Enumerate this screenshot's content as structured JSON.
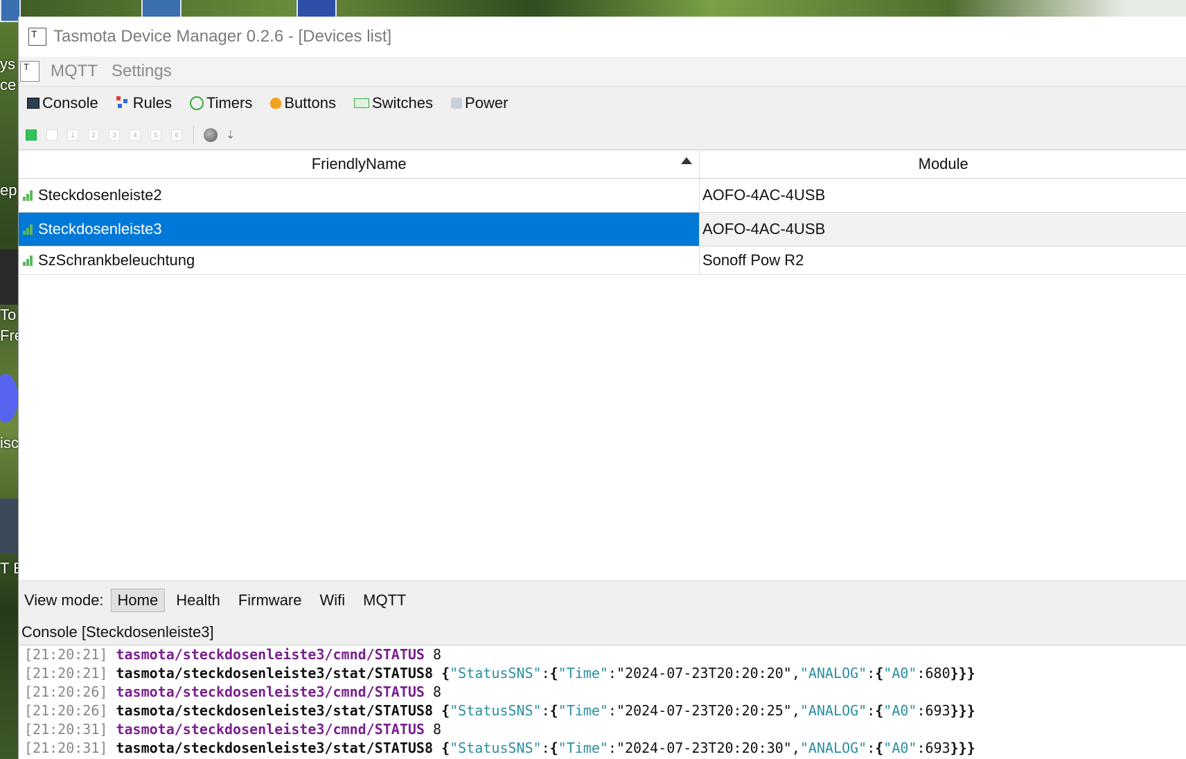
{
  "window": {
    "app_icon_letter": "T",
    "title": "Tasmota Device Manager 0.2.6 - [Devices list]"
  },
  "desktop": {
    "fragments": [
      "ys",
      "ce",
      "ep",
      "To",
      "Fre",
      "iscr",
      "T E"
    ]
  },
  "menubar": {
    "icon_letter": "T",
    "items": [
      "MQTT",
      "Settings"
    ]
  },
  "toolbar": {
    "buttons": [
      {
        "label": "Console",
        "icon": "console-icon"
      },
      {
        "label": "Rules",
        "icon": "rules-icon"
      },
      {
        "label": "Timers",
        "icon": "timers-icon"
      },
      {
        "label": "Buttons",
        "icon": "buttons-icon"
      },
      {
        "label": "Switches",
        "icon": "switches-icon"
      },
      {
        "label": "Power",
        "icon": "power-icon"
      }
    ]
  },
  "ledbar": {
    "leds": [
      "",
      "",
      "1",
      "2",
      "3",
      "4",
      "5",
      "6"
    ]
  },
  "table": {
    "columns": [
      "FriendlyName",
      "Module"
    ],
    "rows": [
      {
        "name": "Steckdosenleiste2",
        "module": "AOFO-4AC-4USB",
        "selected": false
      },
      {
        "name": "Steckdosenleiste3",
        "module": "AOFO-4AC-4USB",
        "selected": true
      },
      {
        "name": "SzSchrankbeleuchtung",
        "module": "Sonoff Pow R2",
        "selected": false
      }
    ]
  },
  "viewmode": {
    "label": "View mode:",
    "tabs": [
      "Home",
      "Health",
      "Firmware",
      "Wifi",
      "MQTT"
    ],
    "active": "Home"
  },
  "console": {
    "title": "Console [Steckdosenleiste3]",
    "lines": [
      {
        "ts": "[21:20:21]",
        "topic": "tasmota/steckdosenleiste3/cmnd/STATUS",
        "kind": "cmnd",
        "payload": "8"
      },
      {
        "ts": "[21:20:21]",
        "topic": "tasmota/steckdosenleiste3/stat/STATUS8",
        "kind": "stat",
        "time": "2024-07-23T20:20:20",
        "a0": "680"
      },
      {
        "ts": "[21:20:26]",
        "topic": "tasmota/steckdosenleiste3/cmnd/STATUS",
        "kind": "cmnd",
        "payload": "8"
      },
      {
        "ts": "[21:20:26]",
        "topic": "tasmota/steckdosenleiste3/stat/STATUS8",
        "kind": "stat",
        "time": "2024-07-23T20:20:25",
        "a0": "693"
      },
      {
        "ts": "[21:20:31]",
        "topic": "tasmota/steckdosenleiste3/cmnd/STATUS",
        "kind": "cmnd",
        "payload": "8"
      },
      {
        "ts": "[21:20:31]",
        "topic": "tasmota/steckdosenleiste3/stat/STATUS8",
        "kind": "stat",
        "time": "2024-07-23T20:20:30",
        "a0": "693"
      }
    ],
    "json_keys": {
      "status_sns": "StatusSNS",
      "time": "Time",
      "analog": "ANALOG",
      "a0": "A0"
    }
  }
}
